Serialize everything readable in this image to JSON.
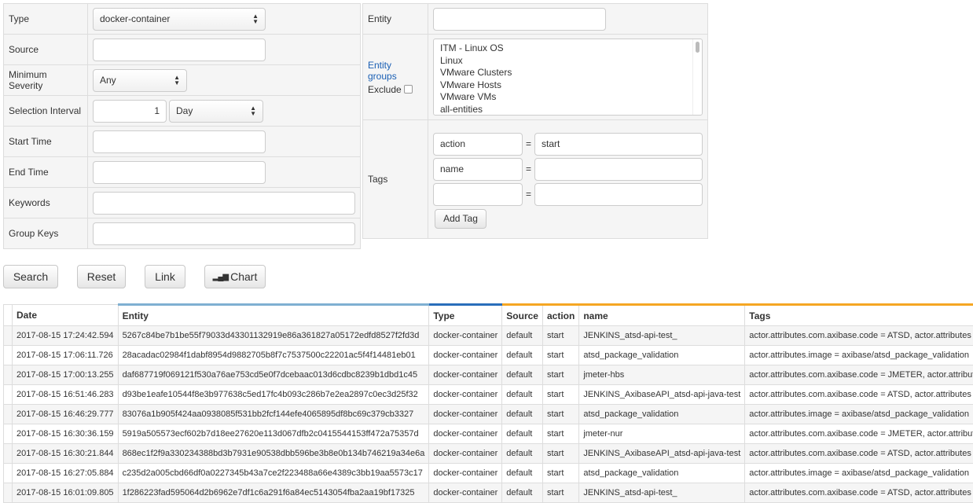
{
  "filters": {
    "type": {
      "label": "Type",
      "value": "docker-container"
    },
    "source": {
      "label": "Source",
      "value": ""
    },
    "min_severity": {
      "label": "Minimum Severity",
      "value": "Any"
    },
    "interval": {
      "label": "Selection Interval",
      "count": "1",
      "unit": "Day"
    },
    "start_time": {
      "label": "Start Time",
      "value": ""
    },
    "end_time": {
      "label": "End Time",
      "value": ""
    },
    "keywords": {
      "label": "Keywords",
      "value": ""
    },
    "group_keys": {
      "label": "Group Keys",
      "value": ""
    }
  },
  "entity": {
    "label": "Entity",
    "value": ""
  },
  "entity_groups": {
    "label": "Entity groups",
    "exclude_label": "Exclude",
    "exclude_checked": false,
    "options": [
      "ITM - Linux OS",
      "Linux",
      "VMware Clusters",
      "VMware Hosts",
      "VMware VMs",
      "all-entities"
    ]
  },
  "tags": {
    "label": "Tags",
    "add_label": "Add Tag",
    "rows": [
      {
        "key": "action",
        "value": "start"
      },
      {
        "key": "name",
        "value": ""
      },
      {
        "key": "",
        "value": ""
      }
    ],
    "eq": "="
  },
  "buttons": {
    "search": "Search",
    "reset": "Reset",
    "link": "Link",
    "chart": "Chart"
  },
  "colors": {
    "entity_header": "#7fb0d2",
    "type_header": "#2a6ebb",
    "tag_header": "#f5a623",
    "link": "#1a5fb4"
  },
  "table": {
    "columns": [
      "Date",
      "Entity",
      "Type",
      "Source",
      "action",
      "name",
      "Tags"
    ],
    "rows": [
      [
        "2017-08-15 17:24:42.594",
        "5267c84be7b1be55f79033d43301132919e86a361827a05172edfd8527f2fd3d",
        "docker-container",
        "default",
        "start",
        "JENKINS_atsd-api-test_",
        "actor.attributes.com.axibase.code = ATSD, actor.attributes"
      ],
      [
        "2017-08-15 17:06:11.726",
        "28acadac02984f1dabf8954d9882705b8f7c7537500c22201ac5f4f14481eb01",
        "docker-container",
        "default",
        "start",
        "atsd_package_validation",
        "actor.attributes.image = axibase/atsd_package_validation"
      ],
      [
        "2017-08-15 17:00:13.255",
        "daf687719f069121f530a76ae753cd5e0f7dcebaac013d6cdbc8239b1dbd1c45",
        "docker-container",
        "default",
        "start",
        "jmeter-hbs",
        "actor.attributes.com.axibase.code = JMETER, actor.attributes"
      ],
      [
        "2017-08-15 16:51:46.283",
        "d93be1eafe10544f8e3b977638c5ed17fc4b093c286b7e2ea2897c0ec3d25f32",
        "docker-container",
        "default",
        "start",
        "JENKINS_AxibaseAPI_atsd-api-java-test",
        "actor.attributes.com.axibase.code = ATSD, actor.attributes"
      ],
      [
        "2017-08-15 16:46:29.777",
        "83076a1b905f424aa0938085f531bb2fcf144efe4065895df8bc69c379cb3327",
        "docker-container",
        "default",
        "start",
        "atsd_package_validation",
        "actor.attributes.image = axibase/atsd_package_validation"
      ],
      [
        "2017-08-15 16:30:36.159",
        "5919a505573ecf602b7d18ee27620e113d067dfb2c0415544153ff472a75357d",
        "docker-container",
        "default",
        "start",
        "jmeter-nur",
        "actor.attributes.com.axibase.code = JMETER, actor.attributes"
      ],
      [
        "2017-08-15 16:30:21.844",
        "868ec1f2f9a330234388bd3b7931e90538dbb596be3b8e0b134b746219a34e6a",
        "docker-container",
        "default",
        "start",
        "JENKINS_AxibaseAPI_atsd-api-java-test",
        "actor.attributes.com.axibase.code = ATSD, actor.attributes"
      ],
      [
        "2017-08-15 16:27:05.884",
        "c235d2a005cbd66df0a0227345b43a7ce2f223488a66e4389c3bb19aa5573c17",
        "docker-container",
        "default",
        "start",
        "atsd_package_validation",
        "actor.attributes.image = axibase/atsd_package_validation"
      ],
      [
        "2017-08-15 16:01:09.805",
        "1f286223fad595064d2b6962e7df1c6a291f6a84ec5143054fba2aa19bf17325",
        "docker-container",
        "default",
        "start",
        "JENKINS_atsd-api-test_",
        "actor.attributes.com.axibase.code = ATSD, actor.attributes"
      ]
    ]
  }
}
